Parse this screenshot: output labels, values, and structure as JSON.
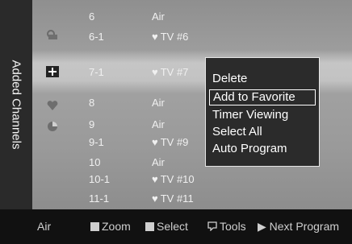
{
  "panel": {
    "title": "Added Channels"
  },
  "channels": [
    {
      "number": "6",
      "name": "Air",
      "favorite": false
    },
    {
      "number": "6-1",
      "name": "TV #6",
      "favorite": true
    },
    {
      "number": "7-1",
      "name": "TV #7",
      "favorite": true,
      "selected": true
    },
    {
      "number": "8",
      "name": "Air",
      "favorite": false
    },
    {
      "number": "9",
      "name": "Air",
      "favorite": false
    },
    {
      "number": "9-1",
      "name": "TV #9",
      "favorite": true
    },
    {
      "number": "10",
      "name": "Air",
      "favorite": false
    },
    {
      "number": "10-1",
      "name": "TV #10",
      "favorite": true
    },
    {
      "number": "11-1",
      "name": "TV #11",
      "favorite": true
    }
  ],
  "favorite_symbol": "♥",
  "context_menu": {
    "items": [
      {
        "label": "Delete"
      },
      {
        "label": "Add to Favorite",
        "highlighted": true
      },
      {
        "label": "Timer Viewing"
      },
      {
        "label": "Select All"
      },
      {
        "label": "Auto Program"
      }
    ]
  },
  "bottom_bar": {
    "source": "Air",
    "zoom": "Zoom",
    "select": "Select",
    "tools": "Tools",
    "next_program": "▶ Next Program"
  },
  "icons": {
    "lock": "lock-icon",
    "edit": "edit-icon",
    "favorite_heart": "heart-icon",
    "tv_program": "tv-program-icon",
    "tools": "tools-icon"
  }
}
